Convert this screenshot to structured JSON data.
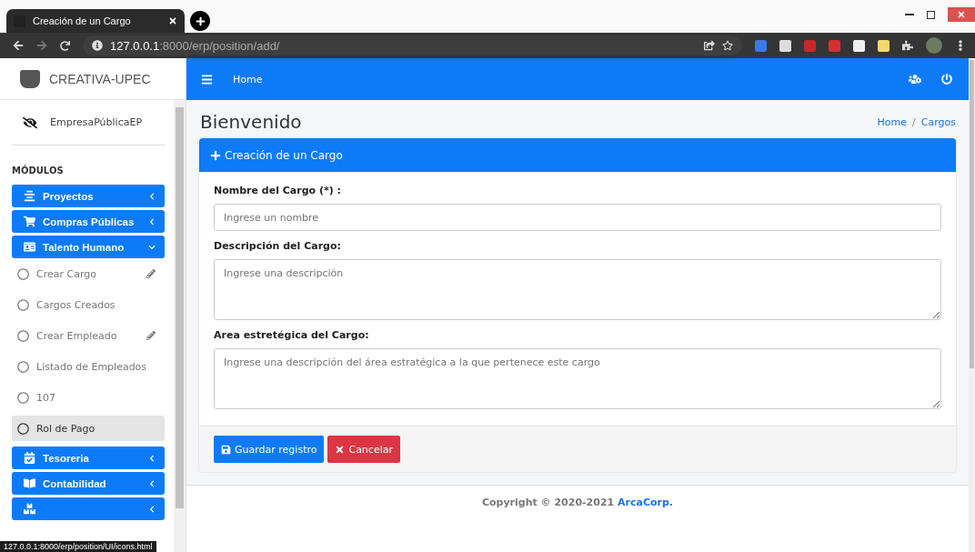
{
  "browser": {
    "tab_title": "Creación de un Cargo",
    "url_host": "127.0.0.1",
    "url_path": ":8000/erp/position/add/",
    "status_url": "127.0.0.1:8000/erp/position/UI/icons.html"
  },
  "brand": "CREATIVA-UPEC",
  "user": "EmpresaPúblicaEP",
  "sidebar": {
    "header": "MÓDULOS",
    "items": [
      {
        "kind": "group",
        "label": "Proyectos",
        "expanded": false
      },
      {
        "kind": "group",
        "label": "Compras Públicas",
        "expanded": false
      },
      {
        "kind": "group",
        "label": "Talento Humano",
        "expanded": true,
        "children": [
          {
            "label": "Crear Cargo",
            "editable": true,
            "selected": false
          },
          {
            "label": "Cargos Creados",
            "editable": false,
            "selected": false
          },
          {
            "label": "Crear Empleado",
            "editable": true,
            "selected": false
          },
          {
            "label": "Listado de Empleados",
            "editable": false,
            "selected": false
          },
          {
            "label": "107",
            "editable": false,
            "selected": false
          },
          {
            "label": "Rol de Pago",
            "editable": false,
            "selected": true
          }
        ]
      },
      {
        "kind": "group",
        "label": "Tesoreria",
        "expanded": false
      },
      {
        "kind": "group",
        "label": "Contabilidad",
        "expanded": false
      },
      {
        "kind": "group",
        "expanded": false
      }
    ]
  },
  "navbar": {
    "link": "Home"
  },
  "page": {
    "title": "Bienvenido",
    "breadcrumb": [
      "Home",
      "Cargos"
    ],
    "breadcrumb_separator": "/"
  },
  "card": {
    "title": "Creación de un Cargo",
    "fields": [
      {
        "kind": "input",
        "label": "Nombre del Cargo (*) :",
        "placeholder": "Ingrese un nombre"
      },
      {
        "kind": "textarea",
        "label": "Descripción del Cargo:",
        "placeholder": "Ingrese una descripción"
      },
      {
        "kind": "textarea",
        "label": "Area estretégica del Cargo:",
        "placeholder": "Ingrese una descripción del área estratégica a la que pertenece este cargo"
      }
    ],
    "buttons": [
      {
        "kind": "primary",
        "label": "Guardar registro"
      },
      {
        "kind": "danger",
        "label": "Cancelar"
      }
    ]
  },
  "footer": {
    "text": "Copyright © 2020-2021 ",
    "link": "ArcaCorp."
  }
}
